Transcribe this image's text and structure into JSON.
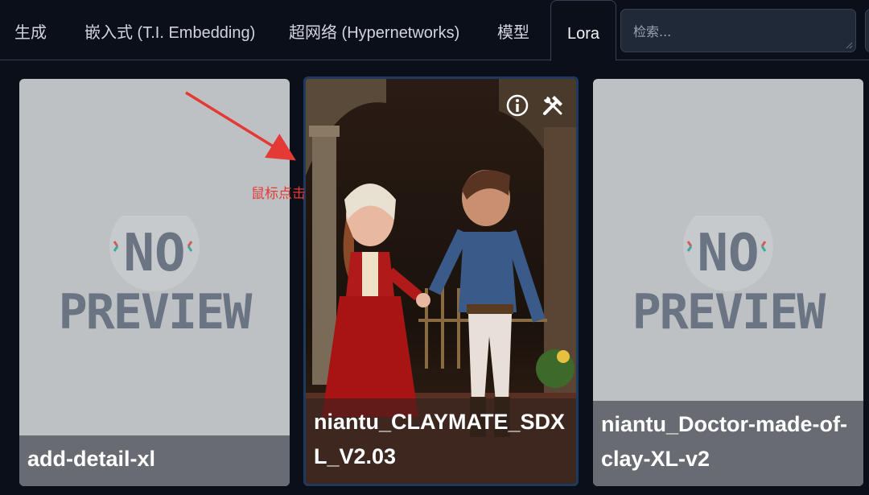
{
  "tabs": [
    {
      "label": "生成",
      "active": false
    },
    {
      "label": "嵌入式 (T.I. Embedding)",
      "active": false
    },
    {
      "label": "超网络 (Hypernetworks)",
      "active": false
    },
    {
      "label": "模型",
      "active": false
    },
    {
      "label": "Lora",
      "active": true
    }
  ],
  "search": {
    "placeholder": "检索..."
  },
  "cards": [
    {
      "name": "add-detail-xl",
      "preview": "no-preview"
    },
    {
      "name": "niantu_CLAYMATE_SDXL_V2.03",
      "preview": "clay-couple-image",
      "selected": true
    },
    {
      "name": "niantu_Doctor-made-of-clay-XL-v2",
      "preview": "no-preview"
    }
  ],
  "card_icons": [
    "info-icon",
    "tools-icon"
  ],
  "annotation": {
    "text": "鼠标点击",
    "color": "#e53935"
  },
  "colors": {
    "background": "#0b0f19",
    "card_placeholder": "#bec1c4",
    "selected_border": "#1e3a5f"
  }
}
